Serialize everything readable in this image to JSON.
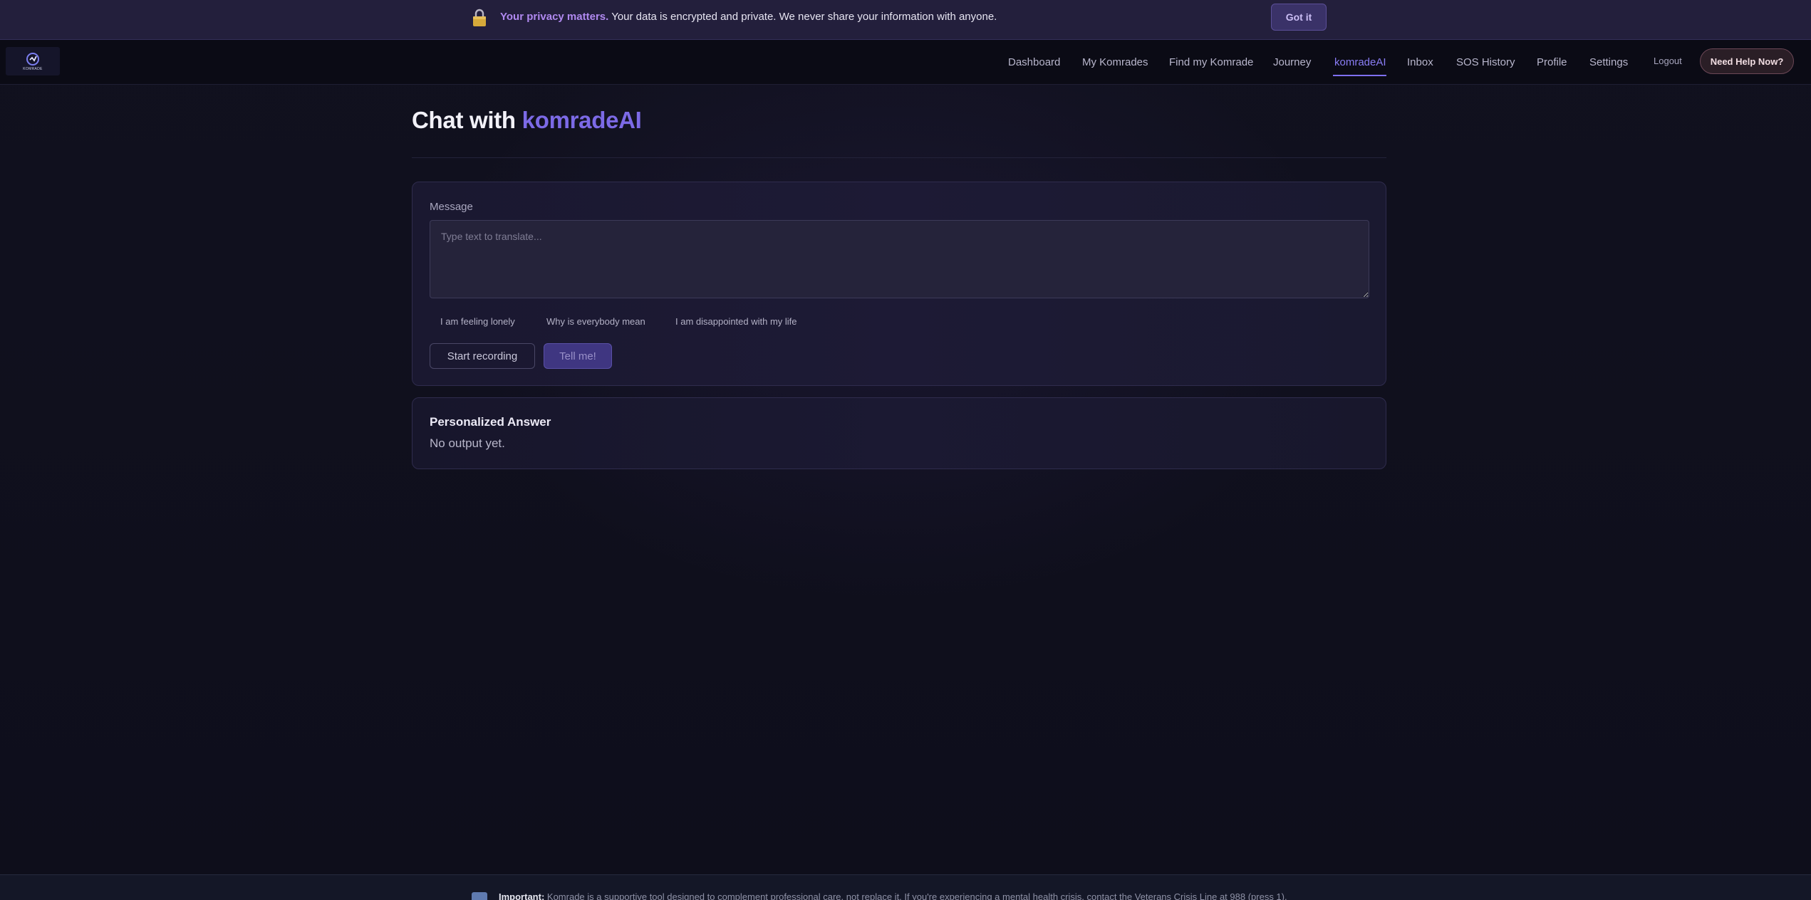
{
  "privacy_banner": {
    "strong": "Your privacy matters.",
    "text": "Your data is encrypted and private. We never share your information with anyone.",
    "button": "Got it"
  },
  "logo": {
    "text": "KOMRADE"
  },
  "nav": {
    "items": [
      {
        "label": "Dashboard"
      },
      {
        "label": "My Komrades"
      },
      {
        "label": "Find my Komrade"
      },
      {
        "label": "Journey"
      },
      {
        "label": "komradeAI",
        "active": true
      },
      {
        "label": "Inbox"
      },
      {
        "label": "SOS History"
      },
      {
        "label": "Profile"
      },
      {
        "label": "Settings"
      }
    ],
    "logout": "Logout",
    "help_button": "Need Help Now?"
  },
  "page": {
    "title_prefix": "Chat with",
    "title_accent": "komradeAI"
  },
  "message_form": {
    "label": "Message",
    "placeholder": "Type text to translate...",
    "value": "",
    "suggestions": [
      "I am feeling lonely",
      "Why is everybody mean",
      "I am disappointed with my life"
    ],
    "record_button": "Start recording",
    "submit_button": "Tell me!"
  },
  "answer": {
    "title": "Personalized Answer",
    "body": "No output yet."
  },
  "footer": {
    "strong": "Important:",
    "text": "Komrade is a supportive tool designed to complement professional care, not replace it. If you're experiencing a mental health crisis, contact the Veterans Crisis Line at 988 (press 1)."
  },
  "colors": {
    "accent": "#7c6ae6",
    "privacy_highlight": "#b089f0",
    "background": "#0f0f1c"
  }
}
